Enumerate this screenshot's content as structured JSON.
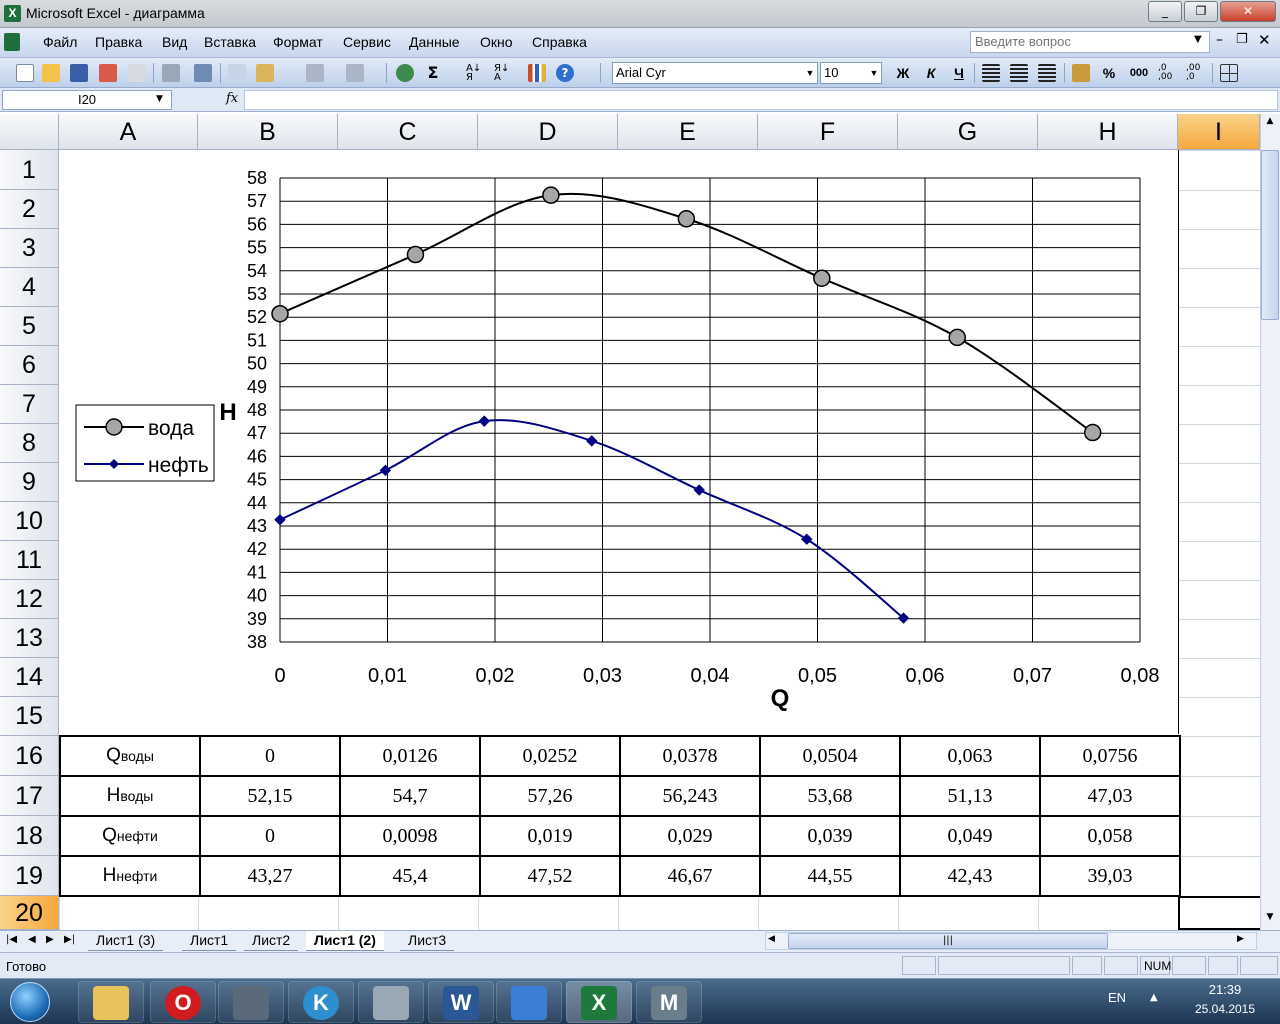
{
  "window": {
    "title": "Microsoft Excel - диаграмма"
  },
  "menu": {
    "items": [
      "Файл",
      "Правка",
      "Вид",
      "Вставка",
      "Формат",
      "Сервис",
      "Данные",
      "Окно",
      "Справка"
    ],
    "ask_placeholder": "Введите вопрос"
  },
  "toolbar": {
    "font": "Arial Cyr",
    "size": "10",
    "bold": "Ж",
    "italic": "К",
    "underline": "Ч",
    "percent": "%",
    "thousands": "000"
  },
  "formula": {
    "cell": "I20",
    "fx": "fx",
    "value": ""
  },
  "columns": [
    "A",
    "B",
    "C",
    "D",
    "E",
    "F",
    "G",
    "H",
    "I"
  ],
  "active_column": "I",
  "rows": [
    "1",
    "2",
    "3",
    "4",
    "5",
    "6",
    "7",
    "8",
    "9",
    "10",
    "11",
    "12",
    "13",
    "14",
    "15",
    "16",
    "17",
    "18",
    "19",
    "20"
  ],
  "active_row": "20",
  "table": {
    "rows": [
      {
        "label": "Q",
        "sub": "воды",
        "values": [
          "0",
          "0,0126",
          "0,0252",
          "0,0378",
          "0,0504",
          "0,063",
          "0,0756"
        ]
      },
      {
        "label": "H",
        "sub": "воды",
        "values": [
          "52,15",
          "54,7",
          "57,26",
          "56,243",
          "53,68",
          "51,13",
          "47,03"
        ]
      },
      {
        "label": "Q",
        "sub": "нефти",
        "values": [
          "0",
          "0,0098",
          "0,019",
          "0,029",
          "0,039",
          "0,049",
          "0,058"
        ]
      },
      {
        "label": "H",
        "sub": "нефти",
        "values": [
          "43,27",
          "45,4",
          "47,52",
          "46,67",
          "44,55",
          "42,43",
          "39,03"
        ]
      }
    ]
  },
  "chart_data": {
    "type": "scatter",
    "title": "",
    "xlabel": "Q",
    "ylabel": "H",
    "xlim": [
      0,
      0.08
    ],
    "ylim": [
      38,
      58
    ],
    "x_ticks": [
      "0",
      "0,01",
      "0,02",
      "0,03",
      "0,04",
      "0,05",
      "0,06",
      "0,07",
      "0,08"
    ],
    "y_ticks": [
      "38",
      "39",
      "40",
      "41",
      "42",
      "43",
      "44",
      "45",
      "46",
      "47",
      "48",
      "49",
      "50",
      "51",
      "52",
      "53",
      "54",
      "55",
      "56",
      "57",
      "58"
    ],
    "grid": "horizontal",
    "legend_position": "left",
    "smooth": true,
    "series": [
      {
        "name": "вода",
        "color": "#000000",
        "marker": "circle",
        "marker_fill": "#a6a6a6",
        "x": [
          0,
          0.0126,
          0.0252,
          0.0378,
          0.0504,
          0.063,
          0.0756
        ],
        "y": [
          52.15,
          54.7,
          57.26,
          56.243,
          53.68,
          51.13,
          47.03
        ]
      },
      {
        "name": "нефть",
        "color": "#000080",
        "marker": "diamond",
        "marker_fill": "#000080",
        "x": [
          0,
          0.0098,
          0.019,
          0.029,
          0.039,
          0.049,
          0.058
        ],
        "y": [
          43.27,
          45.4,
          47.52,
          46.67,
          44.55,
          42.43,
          39.03
        ]
      }
    ]
  },
  "sheet_tabs": [
    "Лист1 (3)",
    "Лист1",
    "Лист2",
    "Лист1 (2)",
    "Лист3"
  ],
  "active_tab": "Лист1 (2)",
  "status": {
    "text": "Готово",
    "num": "NUM"
  },
  "taskbar": {
    "lang": "EN",
    "time": "21:39",
    "date": "25.04.2015"
  }
}
